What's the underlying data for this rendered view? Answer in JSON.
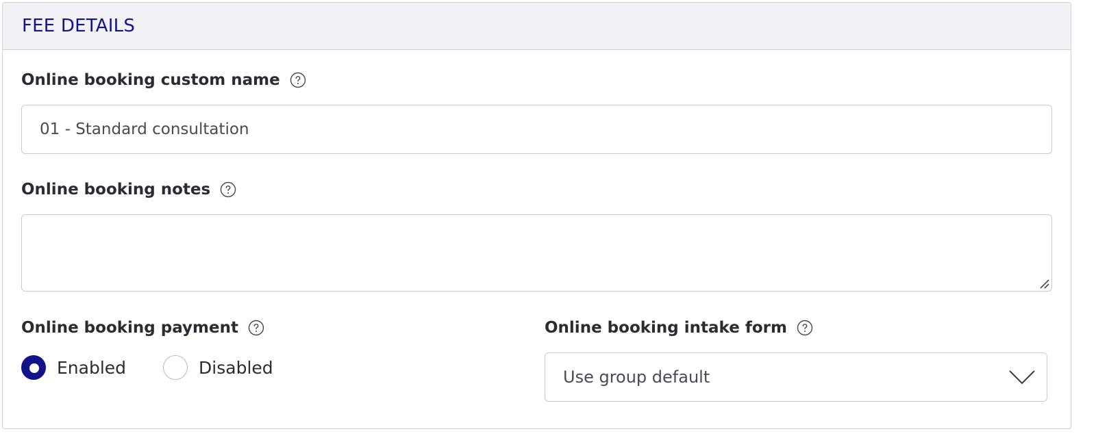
{
  "section": {
    "title": "FEE DETAILS"
  },
  "fields": {
    "custom_name": {
      "label": "Online booking custom name",
      "value": "01 - Standard consultation"
    },
    "notes": {
      "label": "Online booking notes",
      "value": ""
    },
    "payment": {
      "label": "Online booking payment",
      "options": [
        "Enabled",
        "Disabled"
      ],
      "selected": "Enabled"
    },
    "intake_form": {
      "label": "Online booking intake form",
      "value": "Use group default"
    }
  },
  "icons": {
    "help": "question-circle-icon",
    "select_arrow": "chevron-down-icon",
    "resize": "resize-handle-icon"
  },
  "colors": {
    "accent": "#12128a",
    "header_bg": "#f1f1f6",
    "border": "#c9c9d2"
  }
}
